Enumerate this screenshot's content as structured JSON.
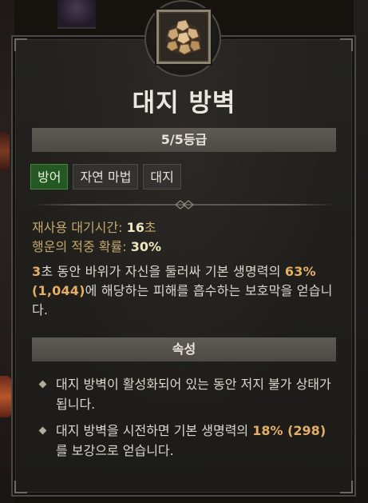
{
  "skill": {
    "icon": "earthen-bulwark-rocks-icon",
    "title": "대지 방벽",
    "rank": "5/5등급",
    "tags": [
      "방어",
      "자연 마법",
      "대지"
    ]
  },
  "stats": {
    "cooldown_label": "재사용 대기시간:",
    "cooldown_value": "16",
    "cooldown_unit": "초",
    "luck_label": "행운의 적중 확률:",
    "luck_value": "30%"
  },
  "description": {
    "part1_num": "3",
    "part1_text": "초 동안 바위가 자신을 둘러싸 기본 생명력의",
    "part2_num": "63% (1,044)",
    "part2_text": "에 해당하는 피해를 흡수하는 보호막을 얻습니다."
  },
  "properties": {
    "header": "속성",
    "items": [
      {
        "text_before": "대지 방벽",
        "text_after": "이 활성화되어 있는 동안 저지 불가 상태가 됩니다."
      },
      {
        "text_before": "대지 방벽",
        "text_mid": "을 시전하면 기본 생명력의 ",
        "num": "18% (298)",
        "text_after": "를 보강으로 얻습니다."
      }
    ]
  },
  "colors": {
    "accent_num": "#e4ae66",
    "stat_label": "#c4a86c",
    "tag_active": "#245722"
  }
}
